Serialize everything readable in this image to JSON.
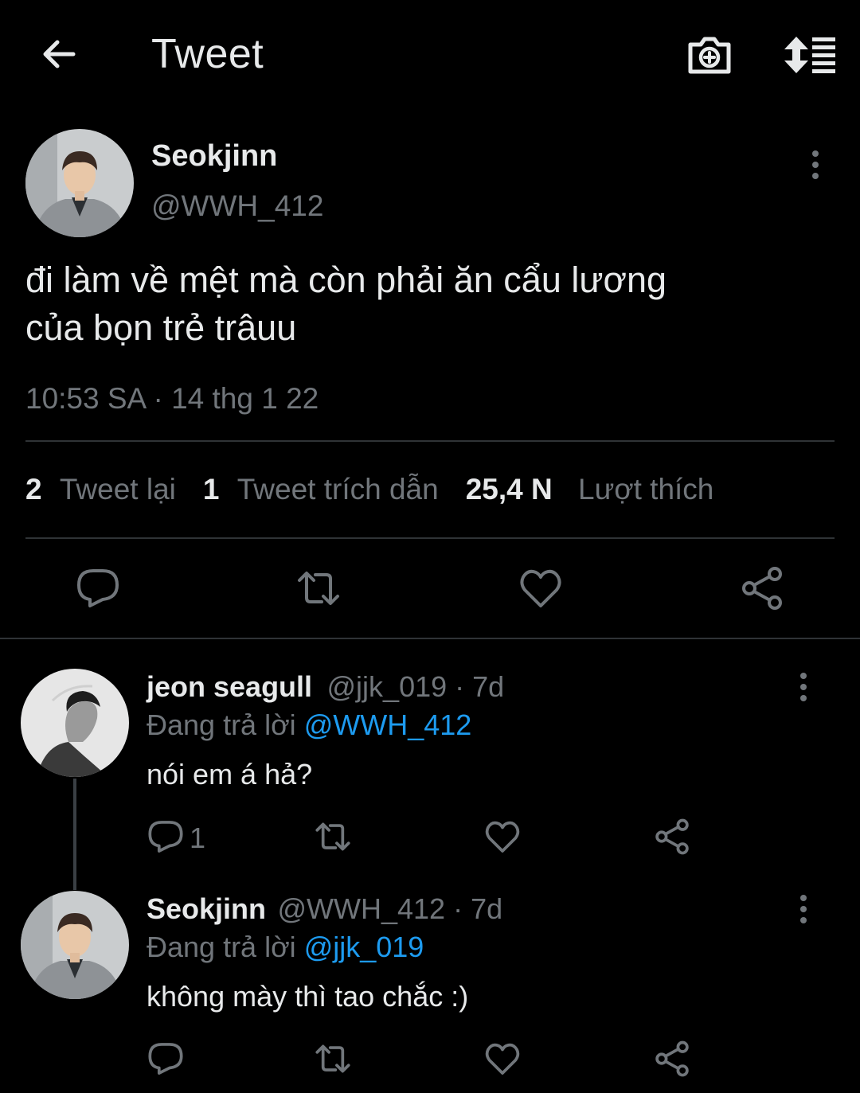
{
  "header": {
    "title": "Tweet",
    "back_icon": "arrow-left-icon",
    "camera_icon": "camera-plus-icon",
    "sort_icon": "sort-list-icon"
  },
  "tweet": {
    "name": "Seokjinn",
    "handle": "@WWH_412",
    "text_line1": "đi làm về mệt mà còn phải ăn cẩu lương",
    "text_line2": "của bọn trẻ trâuu",
    "timestamp": "10:53 SA · 14 thg 1 22",
    "stats": {
      "retweets_count": "2",
      "retweets_label": "Tweet lại",
      "quotes_count": "1",
      "quotes_label": "Tweet trích dẫn",
      "likes_count": "25,4 N",
      "likes_label": "Lượt thích"
    }
  },
  "replies": [
    {
      "name": "jeon seagull",
      "meta": "@jjk_019 · 7d",
      "replying_prefix": "Đang trả lời ",
      "replying_to": "@WWH_412",
      "text": "nói em á hả?",
      "reply_count": "1"
    },
    {
      "name": "Seokjinn",
      "meta": "@WWH_412 · 7d",
      "replying_prefix": "Đang trả lời ",
      "replying_to": "@jjk_019",
      "text": "không mày thì tao chắc :)",
      "reply_count": ""
    }
  ],
  "colors": {
    "background": "#000000",
    "text": "#e7e9ea",
    "muted": "#71767b",
    "link": "#1d9bf0",
    "divider": "#2f3336"
  }
}
